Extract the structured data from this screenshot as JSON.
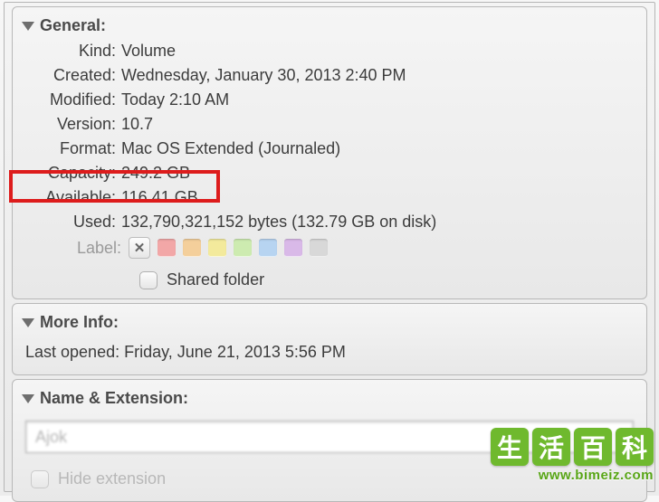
{
  "general": {
    "title": "General:",
    "rows": {
      "kind_label": "Kind:",
      "kind_value": "Volume",
      "created_label": "Created:",
      "created_value": "Wednesday, January 30, 2013 2:40 PM",
      "modified_label": "Modified:",
      "modified_value": "Today 2:10 AM",
      "version_label": "Version:",
      "version_value": "10.7",
      "format_label": "Format:",
      "format_value": "Mac OS Extended (Journaled)",
      "capacity_label": "Capacity:",
      "capacity_value": "249.2 GB",
      "available_label": "Available:",
      "available_value": "116.41 GB",
      "used_label": "Used:",
      "used_value": "132,790,321,152 bytes (132.79 GB on disk)",
      "label_label": "Label:"
    },
    "swatch_colors": [
      "#f2a7a7",
      "#f4cf9b",
      "#f3ea9c",
      "#cdebb0",
      "#b7d4f1",
      "#d9b9e8",
      "#d8d8d8"
    ],
    "shared_folder_label": "Shared folder"
  },
  "more_info": {
    "title": "More Info:",
    "last_opened_label": "Last opened:",
    "last_opened_value": "Friday, June 21, 2013 5:56 PM"
  },
  "name_ext": {
    "title": "Name & Extension:",
    "name_value": "Ajok",
    "hide_extension_label": "Hide extension"
  },
  "watermark": {
    "chars": [
      "生",
      "活",
      "百",
      "科"
    ],
    "url": "www.bimeiz.com"
  }
}
